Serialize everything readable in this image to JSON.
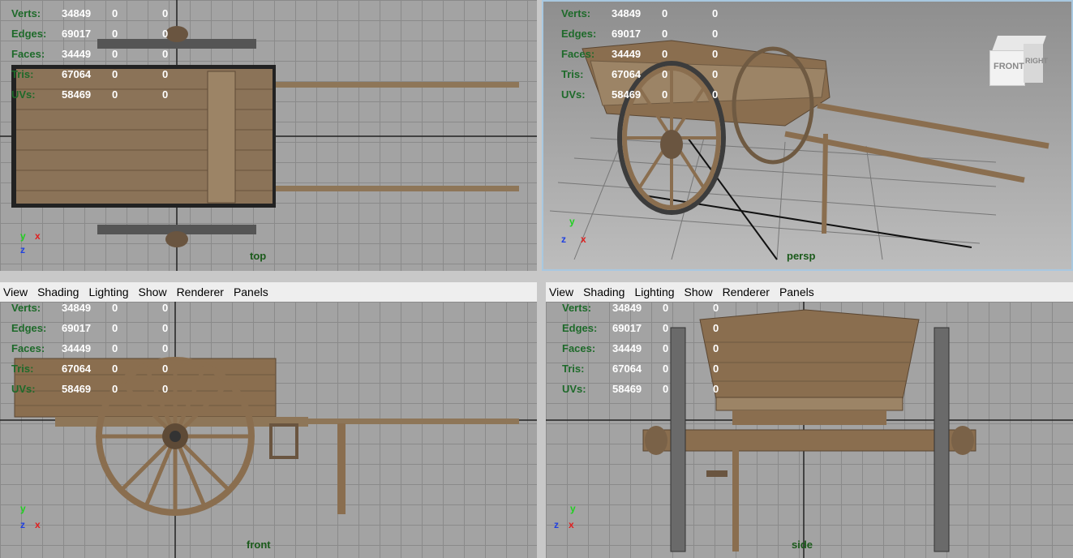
{
  "menu": [
    "View",
    "Shading",
    "Lighting",
    "Show",
    "Renderer",
    "Panels"
  ],
  "hud": {
    "labels": {
      "verts": "Verts:",
      "edges": "Edges:",
      "faces": "Faces:",
      "tris": "Tris:",
      "uvs": "UVs:"
    },
    "values": {
      "verts": "34849",
      "edges": "69017",
      "faces": "34449",
      "tris": "67064",
      "uvs": "58469"
    },
    "sel": "0",
    "comp": "0"
  },
  "cameras": {
    "top": "top",
    "persp": "persp",
    "front": "front",
    "side": "side"
  },
  "viewcube": {
    "front": "FRONT",
    "right": "RIGHT"
  },
  "axes": {
    "x": "x",
    "y": "y",
    "z": "z"
  },
  "colors": {
    "hud_label": "#1e6a2a",
    "axis_x": "#e02020",
    "axis_y": "#20d020",
    "axis_z": "#2040e0",
    "wood": "#8a6e4f"
  }
}
